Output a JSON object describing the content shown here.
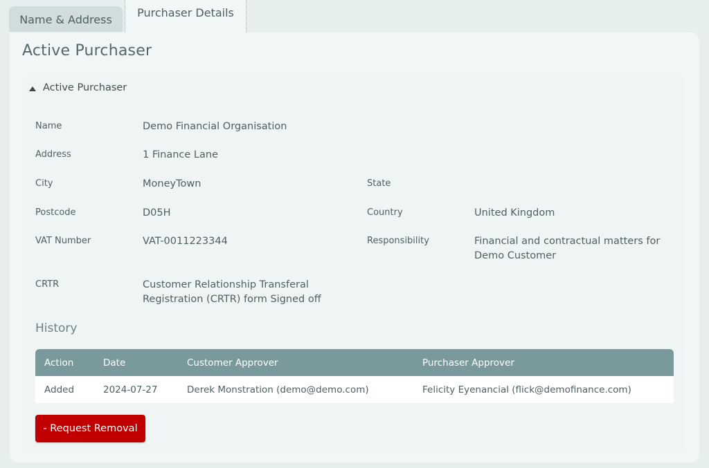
{
  "tabs": [
    {
      "label": "Name & Address",
      "active": false
    },
    {
      "label": "Purchaser Details",
      "active": true
    }
  ],
  "page_title": "Active Purchaser",
  "section": {
    "title": "Active Purchaser",
    "expanded": true,
    "fields": {
      "name": {
        "label": "Name",
        "value": "Demo Financial Organisation"
      },
      "address": {
        "label": "Address",
        "value": "1 Finance Lane"
      },
      "city": {
        "label": "City",
        "value": "MoneyTown"
      },
      "state": {
        "label": "State",
        "value": ""
      },
      "postcode": {
        "label": "Postcode",
        "value": "D05H"
      },
      "country": {
        "label": "Country",
        "value": "United Kingdom"
      },
      "vat": {
        "label": "VAT Number",
        "value": "VAT-0011223344"
      },
      "responsibility": {
        "label": "Responsibility",
        "value_line1": "Financial and contractual matters for",
        "value_line2": "Demo Customer"
      },
      "crtr": {
        "label": "CRTR",
        "value_line1": "Customer Relationship Transferal",
        "value_line2": "Registration (CRTR) form Signed off"
      }
    }
  },
  "history": {
    "title": "History",
    "columns": [
      "Action",
      "Date",
      "Customer Approver",
      "Purchaser Approver"
    ],
    "rows": [
      [
        "Added",
        "2024-07-27",
        "Derek Monstration (demo@demo.com)",
        "Felicity Eyenancial (flick@demofinance.com)"
      ]
    ]
  },
  "actions": {
    "request_removal_label": "- Request Removal"
  },
  "colors": {
    "background": "#e7eeee",
    "panel": "#f1f6f6",
    "table_header": "#7a999c",
    "danger_button": "#c00000"
  }
}
